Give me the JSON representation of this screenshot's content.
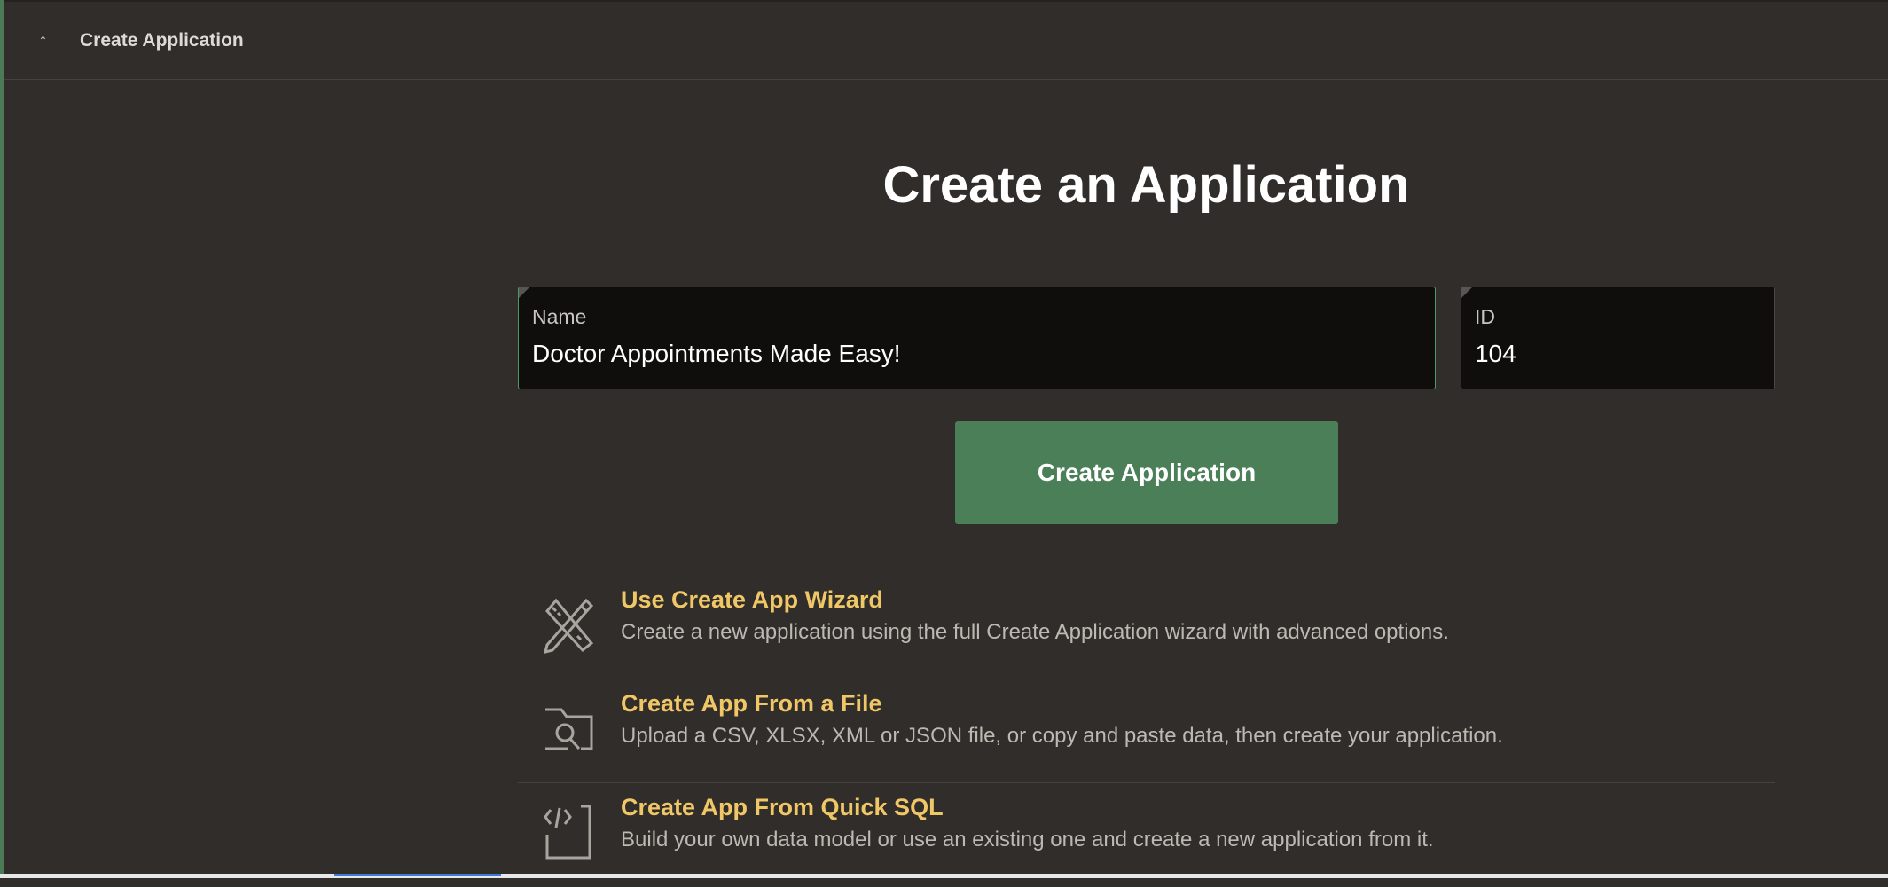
{
  "header": {
    "back_icon": "arrow-up-icon",
    "title": "Create Application"
  },
  "page_title": "Create an Application",
  "name_field": {
    "label": "Name",
    "value": "Doctor Appointments Made Easy!"
  },
  "id_field": {
    "label": "ID",
    "value": "104"
  },
  "create_button": "Create Application",
  "options": [
    {
      "icon": "pencil-ruler-icon",
      "title": "Use Create App Wizard",
      "description": "Create a new application using the full Create Application wizard with advanced options."
    },
    {
      "icon": "folder-search-icon",
      "title": "Create App From a File",
      "description": "Upload a CSV, XLSX, XML or JSON file, or copy and paste data, then create your application."
    },
    {
      "icon": "code-icon",
      "title": "Create App From Quick SQL",
      "description": "Build your own data model or use an existing one and create a new application from it."
    }
  ]
}
